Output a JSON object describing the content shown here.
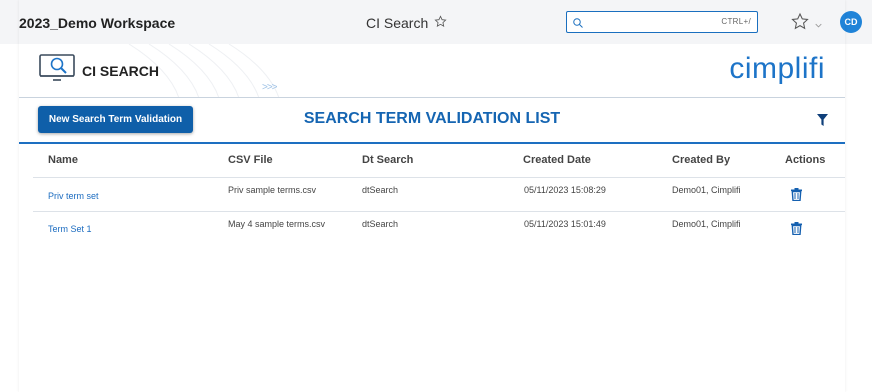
{
  "header": {
    "workspace_title": "2023_Demo Workspace",
    "page_name": "CI Search",
    "search_placeholder": "",
    "search_shortcut": "CTRL+/",
    "user_initials": "CD"
  },
  "banner": {
    "tool_title": "CI SEARCH",
    "chevrons": ">>>",
    "brand": "cimplifi"
  },
  "toolbar": {
    "new_button_label": "New Search Term Validation",
    "list_title": "SEARCH TERM VALIDATION LIST"
  },
  "table": {
    "columns": [
      "Name",
      "CSV File",
      "Dt Search",
      "Created Date",
      "Created By",
      "Actions"
    ],
    "rows": [
      {
        "name": "Priv term set",
        "csv_file": "Priv sample terms.csv",
        "dt_search": "dtSearch",
        "created_date": "05/11/2023 15:08:29",
        "created_by": "Demo01, Cimplifi"
      },
      {
        "name": "Term Set 1",
        "csv_file": "May 4 sample terms.csv",
        "dt_search": "dtSearch",
        "created_date": "05/11/2023 15:01:49",
        "created_by": "Demo01, Cimplifi"
      }
    ]
  },
  "icons": {
    "search": "search-icon",
    "star": "star-outline-icon",
    "filter": "filter-icon",
    "delete": "trash-icon",
    "tool": "ci-search-tool-icon"
  },
  "colors": {
    "accent": "#1d6fc1",
    "button": "#0f5fa9",
    "link": "#1c6cc0",
    "avatar": "#1f83d8"
  }
}
